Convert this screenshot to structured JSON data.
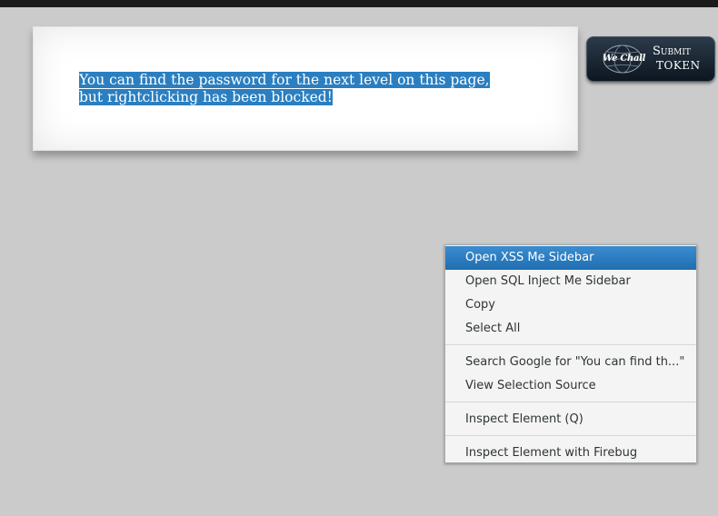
{
  "page": {
    "message_line1": "You can find the password for the next level on this page,",
    "message_line2": "but rightclicking has been blocked!"
  },
  "wechall": {
    "logo_text": "We Chall",
    "submit_label": "Submit",
    "token_label": "TOKEN"
  },
  "context_menu": {
    "items": [
      {
        "label": "Open XSS Me Sidebar",
        "active": true
      },
      {
        "label": "Open SQL Inject Me Sidebar"
      },
      {
        "label": "Copy"
      },
      {
        "label": "Select All"
      },
      {
        "label": "Search Google for \"You can find th...\""
      },
      {
        "label": "View Selection Source"
      },
      {
        "label": "Inspect Element (Q)"
      },
      {
        "label": "Inspect Element with Firebug"
      }
    ]
  },
  "colors": {
    "selection": "#2b7fc0",
    "menu_highlight": "#2a7bbf",
    "page_background": "#cbcbcb"
  }
}
